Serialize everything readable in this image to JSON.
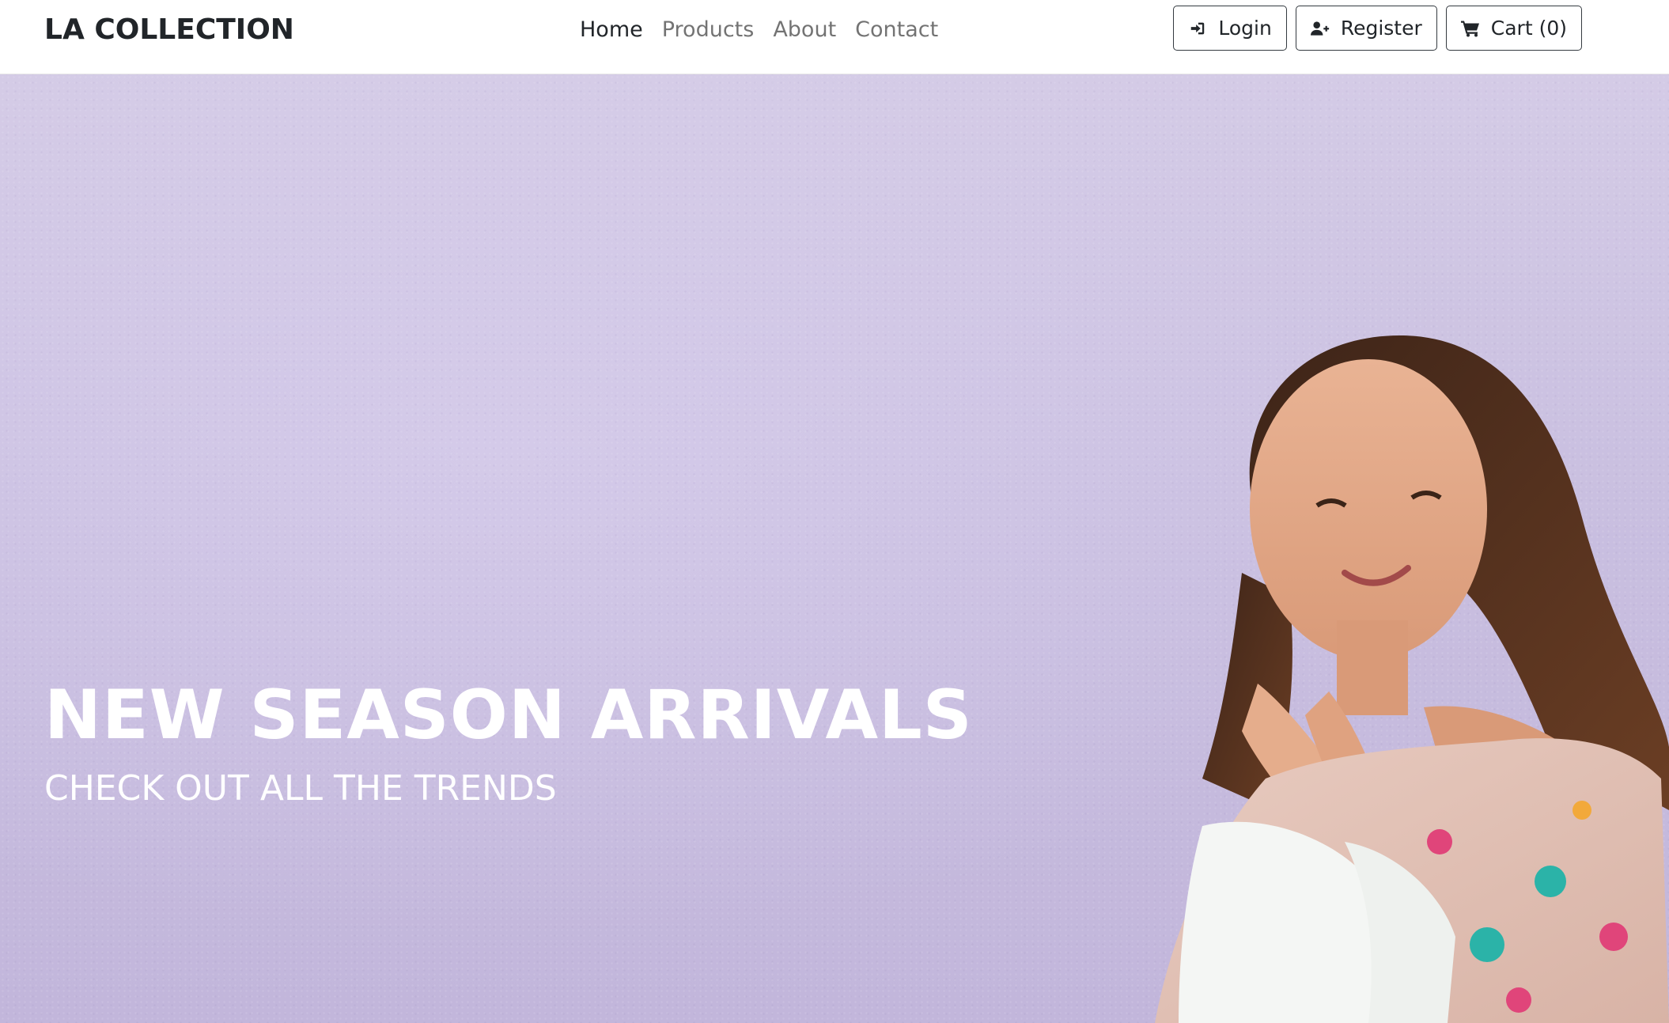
{
  "brand": {
    "name": "LA COLLECTION"
  },
  "nav": {
    "links": [
      {
        "label": "Home",
        "active": true
      },
      {
        "label": "Products",
        "active": false
      },
      {
        "label": "About",
        "active": false
      },
      {
        "label": "Contact",
        "active": false
      }
    ]
  },
  "actions": {
    "login": {
      "label": "Login",
      "icon": "sign-in-icon"
    },
    "register": {
      "label": "Register",
      "icon": "user-plus-icon"
    },
    "cart": {
      "label": "Cart (0)",
      "icon": "cart-icon"
    }
  },
  "hero": {
    "title": "NEW SEASON ARRIVALS",
    "subtitle": "CHECK OUT ALL THE TRENDS",
    "background_color": "#cbc1e0"
  },
  "colors": {
    "text_dark": "#212529",
    "nav_muted": "#8c8c8c",
    "button_border": "#343a40",
    "hero_text": "#ffffff"
  }
}
